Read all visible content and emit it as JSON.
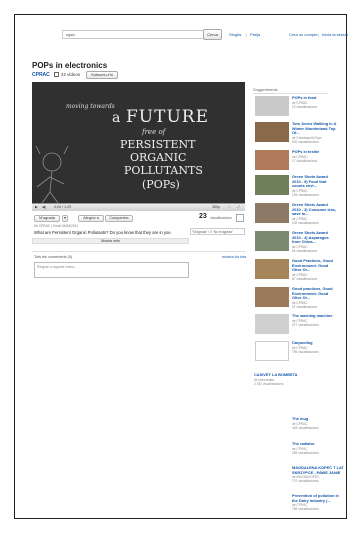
{
  "header": {
    "search_value": "sgslz",
    "search_button": "Cerca",
    "links": [
      "Sfoglia",
      "Parija",
      "Crea un compte",
      "Inicia la sessió"
    ]
  },
  "playlist": {
    "title": "POPs in electronics",
    "channel": "CPRAC",
    "video_count": "22 vídeos",
    "subscribe_label": "Subscriu-t'hi"
  },
  "player": {
    "slide_top": "moving towards",
    "slide_a": "a",
    "slide_future": "FUTURE",
    "slide_free": "free of",
    "slide_line1": "PERSISTENT",
    "slide_line2": "ORGANIC",
    "slide_line3": "POLLUTANTS",
    "slide_line4": "(POPs)",
    "time": "0:00 / 1:29",
    "quality": "360p"
  },
  "video": {
    "like_label": "M'agrada",
    "add_label": "Afegeix a",
    "share_label": "Comparteix",
    "views": "23",
    "views_label": "visualitzacions",
    "byline": "De CPRAC | Creat: 06/04/2011",
    "question": "What are Persistent Organic Pollutants? Do you know that they are in you",
    "tags": "\"M'agrada\" i 0 \"No m'agrada\"",
    "show_more": "Mostra més"
  },
  "comments": {
    "title": "Tots els comentaris (0)",
    "show_all": "mostra-ho tots",
    "placeholder": "Respon a aquest vídeo..."
  },
  "suggestions": {
    "heading": "Suggeriments",
    "items": [
      {
        "title": "POPs in food",
        "by": "de CPRAC",
        "views": "22 visualitzacions"
      },
      {
        "title": "Tom Jones Walking In A Winter Wonderland Top Of...",
        "by": "de ChristmasOnTops",
        "views": "920 visualitzacions"
      },
      {
        "title": "POPs in textile",
        "by": "de CPRAC",
        "views": "17 visualitzacions"
      },
      {
        "title": "Green Shots Award 2010 - 5) Food that counts envi...",
        "by": "de CPRAC",
        "views": "135 visualitzacions"
      },
      {
        "title": "Green Shots Award 2010 - 3) Consume less, save m...",
        "by": "de CPRAC",
        "views": "132 visualitzacions"
      },
      {
        "title": "Green Shots Award 2010 - 4) Asparagus from China...",
        "by": "de CPRAC",
        "views": "84 visualitzacions"
      },
      {
        "title": "Good Practices, Good Environment: Good Olive Or...",
        "by": "de CPRAC",
        "views": "87 visualitzacions"
      },
      {
        "title": "Good practices, Good Environment: Good Olive Or...",
        "by": "de CPRAC",
        "views": "57 visualitzacions"
      },
      {
        "title": "The washing machine",
        "by": "de CPRAC",
        "views": "477 visualitzacions"
      },
      {
        "title": "Carpooling",
        "by": "de CPRAC",
        "views": "755 visualitzacions"
      }
    ],
    "extra_left": {
      "title": "CASIVET LA BOMBETA",
      "by": "de shincreatia",
      "views": "2.782 visualitzacions"
    },
    "extra_right": [
      {
        "title": "The mug",
        "by": "de CPRAC",
        "views": "443 visualitzacions"
      },
      {
        "title": "The radiator",
        "by": "de CPRAC",
        "views": "285 visualitzacions"
      },
      {
        "title": "MAGDALENA KOPEĆ T LAT SKRZYPCE - PAWE JANIE",
        "by": "de MAGDAKOPEC",
        "views": "707 visualitzacions"
      },
      {
        "title": "Prevention of pollution in the Dairy Industry (...",
        "by": "de CPRAC",
        "views": "765 visualitzacions"
      }
    ]
  }
}
